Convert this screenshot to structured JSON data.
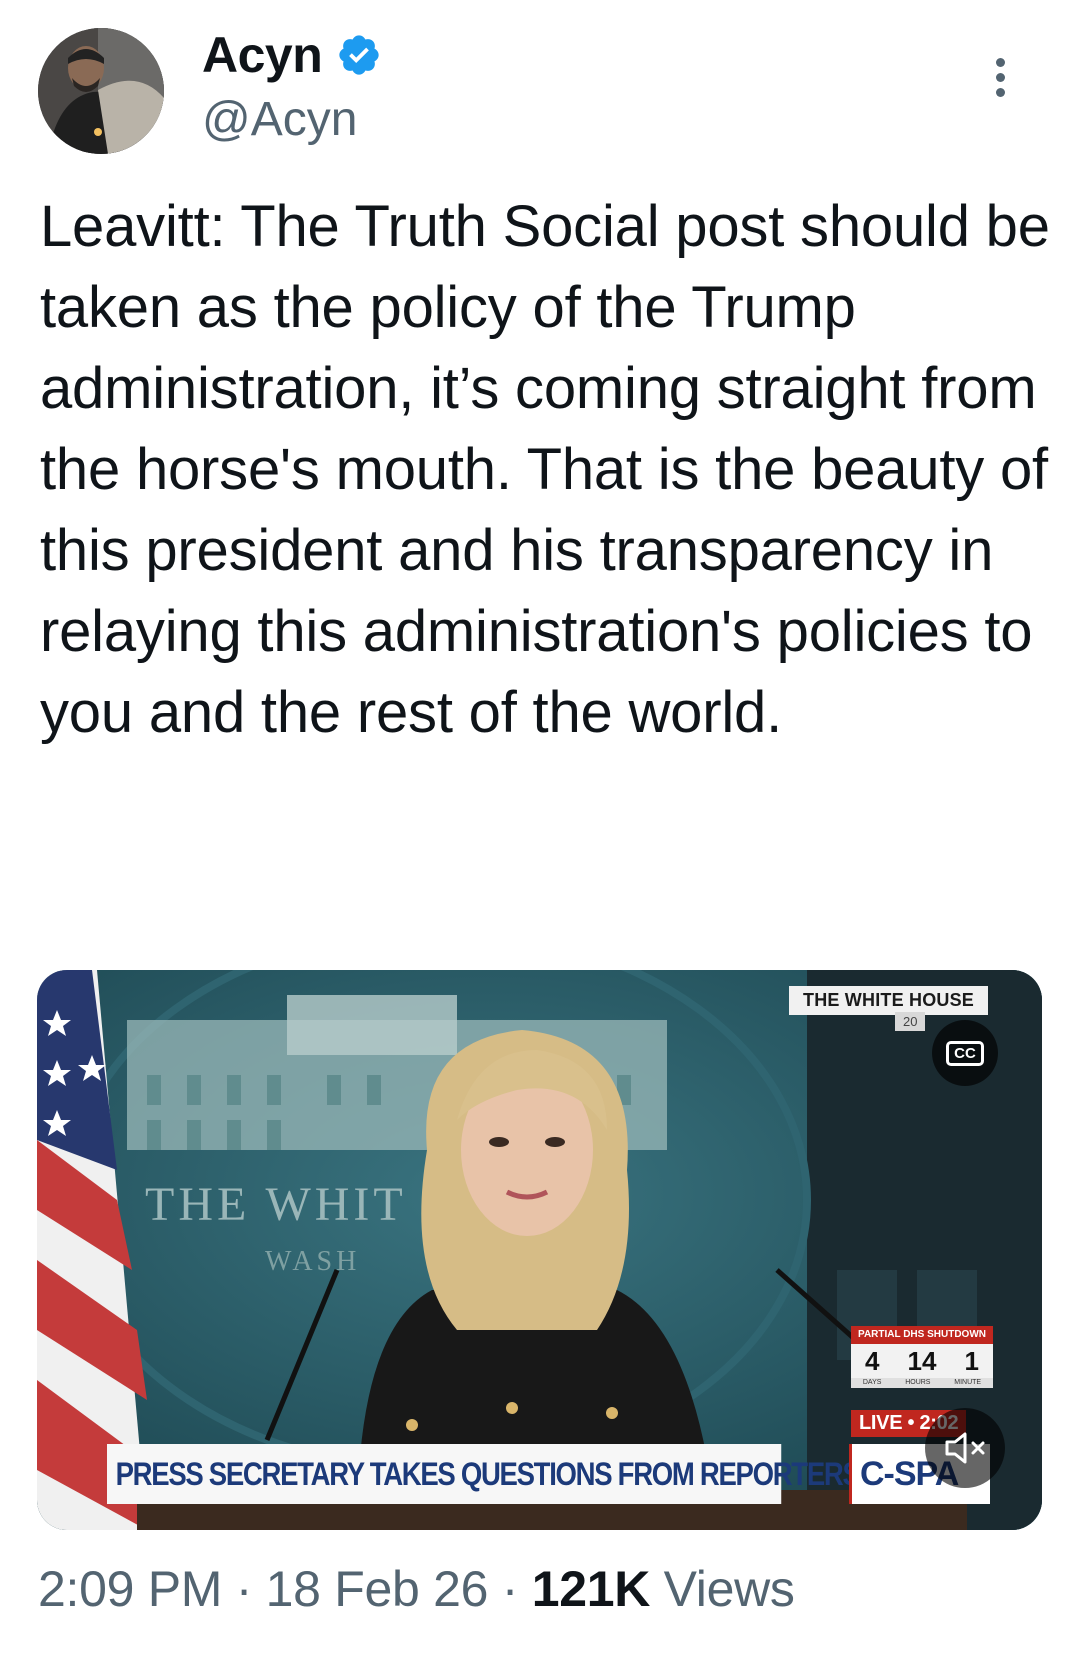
{
  "author": {
    "name": "Acyn",
    "handle": "@Acyn",
    "verified": true,
    "verified_color": "#1d9bf0"
  },
  "tweet": {
    "text": "Leavitt: The Truth Social post should be taken as the policy of the Trump administration, it’s coming straight from the horse's mouth. That is the beauty of this president and his transparency in relaying this administration's policies to you and the rest of the world."
  },
  "video": {
    "backdrop_text_1": "THE WHIT",
    "backdrop_text_2": "WASH",
    "network_label": "THE WHITE HOUSE",
    "network_sub": "20",
    "cc_label": "CC",
    "countdown_title": "PARTIAL DHS SHUTDOWN",
    "countdown_values": [
      "4",
      "14",
      "1"
    ],
    "countdown_units": [
      "DAYS",
      "HOURS",
      "MINUTE"
    ],
    "live_label": "LIVE • 2:02",
    "lower_third": "PRESS SECRETARY TAKES QUESTIONS FROM REPORTERS",
    "lower_third_logo": "C-SPA",
    "muted": true
  },
  "meta": {
    "time": "2:09 PM",
    "separator": " · ",
    "date": "18 Feb 26",
    "views_count": "121K",
    "views_label": " Views"
  },
  "colors": {
    "text": "#0f1419",
    "secondary": "#536471",
    "cspan_blue": "#1c3a7a",
    "cspan_red": "#c0271f"
  }
}
